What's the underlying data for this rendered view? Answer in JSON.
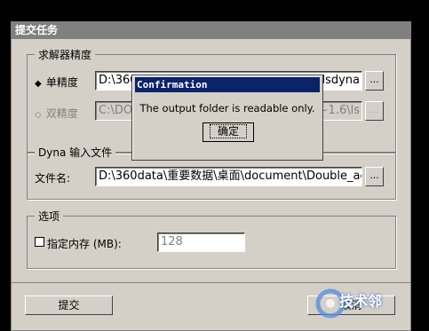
{
  "window": {
    "title": "提交任务"
  },
  "solver_group": {
    "title": "求解器精度",
    "single": {
      "label": "单精度",
      "marker": "◆",
      "path": "D:\\360",
      "path_tail": "lsdyna"
    },
    "double": {
      "label": "双精度",
      "marker": "◇",
      "path": "C:\\DO",
      "path_tail": "~1.6\\ls"
    },
    "browse_label": "..."
  },
  "input_group": {
    "title": "Dyna 输入文件",
    "file_label": "文件名:",
    "file_path": "D:\\360data\\重要数据\\桌面\\document\\Double_ac",
    "browse_label": "..."
  },
  "options_group": {
    "title": "选项",
    "memory_label": "指定内存 (MB):",
    "memory_value": "128",
    "memory_checked": false
  },
  "buttons": {
    "submit_label": "提交",
    "cancel_label": "取消"
  },
  "dialog": {
    "title": "Confirmation",
    "message": "The output folder is readable only.",
    "ok_label": "确定"
  },
  "watermark": {
    "text": "技术邻"
  }
}
